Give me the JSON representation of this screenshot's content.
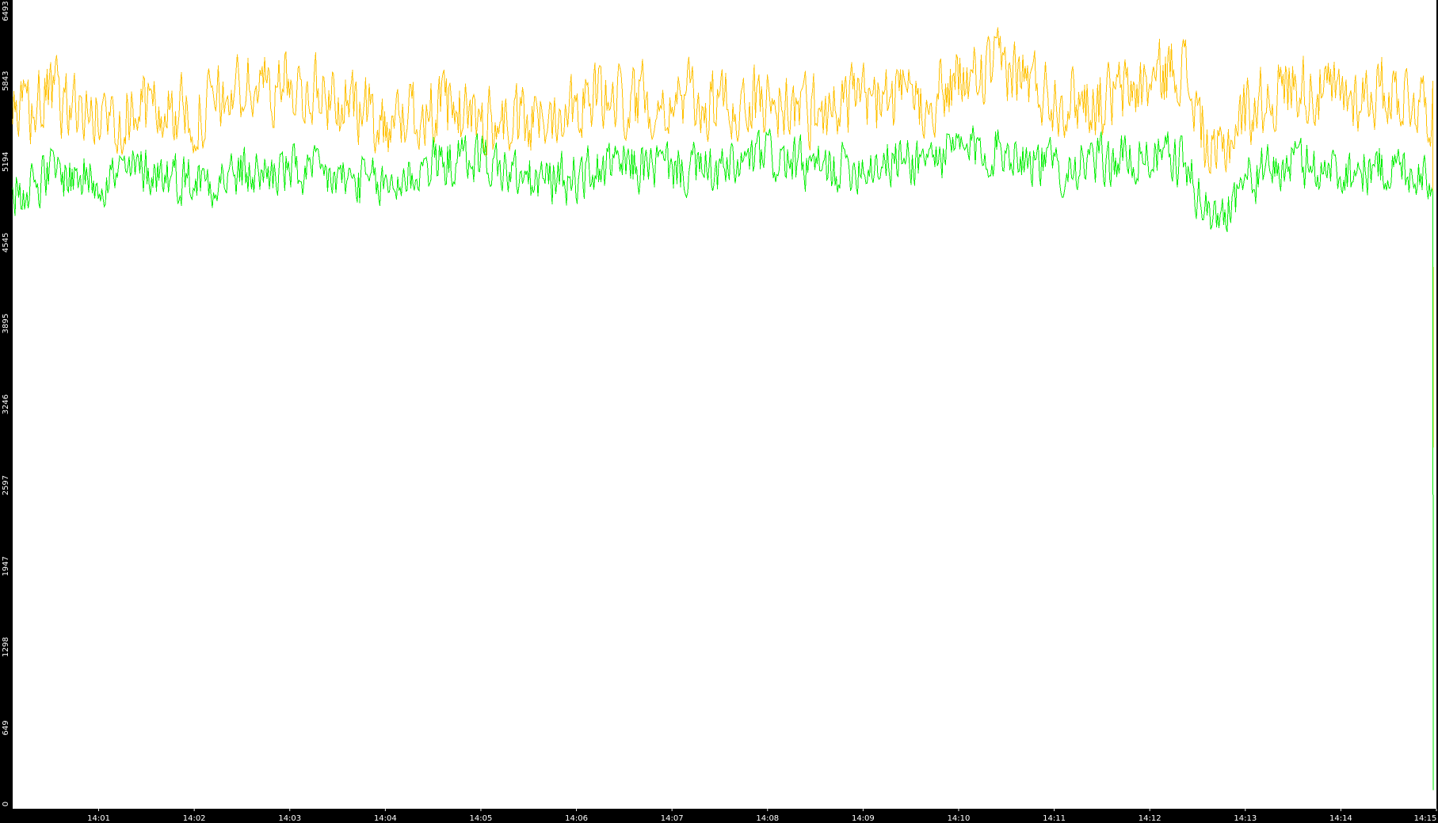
{
  "chart_data": {
    "type": "line",
    "title": "",
    "xlabel": "",
    "ylabel": "",
    "background": "#ffffff",
    "frame_color": "#000000",
    "grid": false,
    "legend": "none",
    "x_range": [
      "14:00:06",
      "14:15:00"
    ],
    "x_ticks": [
      "14:01",
      "14:02",
      "14:03",
      "14:04",
      "14:05",
      "14:06",
      "14:07",
      "14:08",
      "14:09",
      "14:10",
      "14:11",
      "14:12",
      "14:13",
      "14:14",
      "14:15"
    ],
    "y_ticks": [
      0,
      649,
      1298,
      1947,
      2597,
      3246,
      3895,
      4545,
      5194,
      5843,
      6493
    ],
    "ylim": [
      0,
      6493
    ],
    "series": [
      {
        "color": "#ffc000",
        "x": [
          "14:00:06",
          "14:00:30",
          "14:01:00",
          "14:01:30",
          "14:02:00",
          "14:02:30",
          "14:03:00",
          "14:03:30",
          "14:04:00",
          "14:04:30",
          "14:05:00",
          "14:05:30",
          "14:06:00",
          "14:06:30",
          "14:07:00",
          "14:07:30",
          "14:08:00",
          "14:08:30",
          "14:09:00",
          "14:09:30",
          "14:10:00",
          "14:10:30",
          "14:11:00",
          "14:11:30",
          "14:12:00",
          "14:12:20",
          "14:12:40",
          "14:13:00",
          "14:13:30",
          "14:14:00",
          "14:14:30",
          "14:14:58"
        ],
        "values": [
          5500,
          5720,
          5540,
          5630,
          5560,
          5780,
          5820,
          5690,
          5510,
          5620,
          5540,
          5470,
          5720,
          5690,
          5700,
          5640,
          5680,
          5600,
          5690,
          5660,
          5820,
          5960,
          5720,
          5680,
          5820,
          6000,
          5150,
          5600,
          5830,
          5700,
          5780,
          5650
        ]
      },
      {
        "color": "#00ee00",
        "x": [
          "14:00:06",
          "14:00:30",
          "14:01:00",
          "14:01:30",
          "14:02:00",
          "14:02:30",
          "14:03:00",
          "14:03:30",
          "14:04:00",
          "14:04:30",
          "14:05:00",
          "14:05:30",
          "14:06:00",
          "14:06:30",
          "14:07:00",
          "14:07:30",
          "14:08:00",
          "14:08:30",
          "14:09:00",
          "14:09:30",
          "14:10:00",
          "14:10:30",
          "14:11:00",
          "14:11:30",
          "14:12:00",
          "14:12:20",
          "14:12:40",
          "14:13:00",
          "14:13:30",
          "14:14:00",
          "14:14:30",
          "14:14:58"
        ],
        "values": [
          4950,
          5100,
          5060,
          5130,
          5050,
          5090,
          5120,
          5050,
          4990,
          5180,
          5230,
          5020,
          5080,
          5160,
          5150,
          5100,
          5240,
          5120,
          5180,
          5210,
          5280,
          5300,
          5150,
          5180,
          5250,
          5200,
          4700,
          5050,
          5180,
          5120,
          5150,
          5100
        ]
      }
    ]
  }
}
